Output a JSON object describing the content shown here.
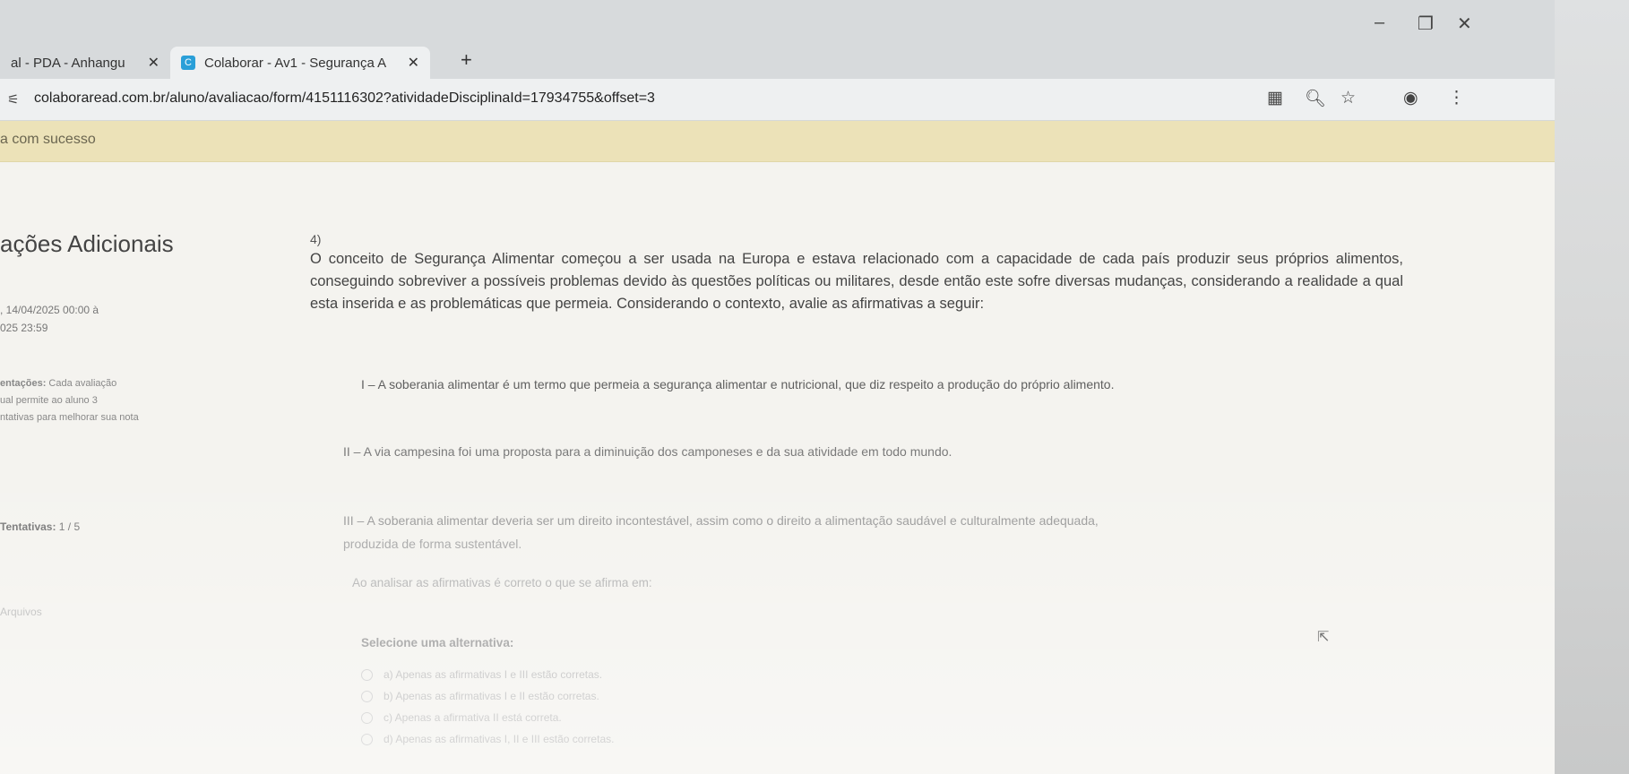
{
  "browser": {
    "tabs": [
      {
        "label": "al - PDA - Anhangu",
        "close": "✕"
      },
      {
        "label": "Colaborar - Av1 - Segurança A",
        "close": "✕"
      }
    ],
    "new_tab": "+",
    "window_controls": {
      "minimize": "–",
      "maximize": "❐",
      "close": "✕"
    },
    "url": "colaboraread.com.br/aluno/avaliacao/form/4151116302?atividadeDisciplinaId=17934755&offset=3",
    "toolbar_icons": [
      "translate-icon",
      "zoom-icon",
      "star-icon",
      "profile-icon",
      "menu-icon"
    ]
  },
  "banner": {
    "text": "a com sucesso"
  },
  "sidebar": {
    "title": "ações Adicionais",
    "date_line1": ", 14/04/2025 00:00 à",
    "date_line2": "025 23:59",
    "orientation_label": "entações:",
    "orientation_line1": " Cada avaliação",
    "orientation_line2": "ual permite ao aluno 3",
    "orientation_line3": "ntativas para melhorar sua nota",
    "attempts_label": "Tentativas:",
    "attempts_value": " 1 / 5",
    "files_label": "Arquivos"
  },
  "question": {
    "number": "4)",
    "intro": "O conceito de Segurança Alimentar começou a ser usada na Europa e estava relacionado com a capacidade de cada país produzir seus próprios alimentos, conseguindo sobreviver a possíveis problemas devido às questões políticas ou militares, desde então este sofre diversas mudanças, considerando a realidade a qual esta inserida e as problemáticas que permeia. Considerando o contexto, avalie as afirmativas a seguir:",
    "affirmatives": [
      "I – A soberania alimentar é um termo que permeia a segurança alimentar e nutricional, que diz respeito a produção do próprio alimento.",
      "II – A via campesina foi uma proposta para a diminuição dos camponeses e da sua atividade em todo mundo.",
      "III – A soberania alimentar deveria ser um direito incontestável, assim como o direito a alimentação saudável e culturalmente adequada,",
      "produzida de forma sustentável."
    ],
    "prompt": "Ao analisar as afirmativas é correto o que se afirma em:",
    "select_title": "Selecione uma alternativa:",
    "options": [
      "a) Apenas as afirmativas I e III estão corretas.",
      "b) Apenas as afirmativas I e II estão corretas.",
      "c) Apenas a afirmativa II está correta.",
      "d) Apenas as afirmativas I, II e III estão corretas."
    ]
  }
}
